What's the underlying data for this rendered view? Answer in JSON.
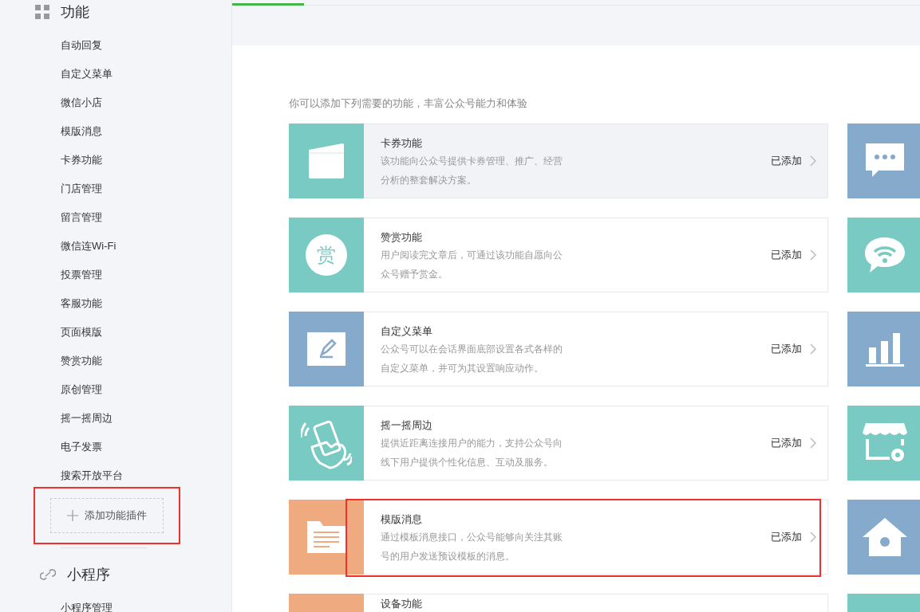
{
  "sidebar": {
    "sections": [
      {
        "kind": "grid",
        "title": "功能",
        "items": [
          {
            "label": "自动回复"
          },
          {
            "label": "自定义菜单"
          },
          {
            "label": "微信小店"
          },
          {
            "label": "模版消息"
          },
          {
            "label": "卡券功能"
          },
          {
            "label": "门店管理"
          },
          {
            "label": "留言管理"
          },
          {
            "label": "微信连Wi-Fi"
          },
          {
            "label": "投票管理"
          },
          {
            "label": "客服功能"
          },
          {
            "label": "页面模版"
          },
          {
            "label": "赞赏功能"
          },
          {
            "label": "原创管理"
          },
          {
            "label": "摇一摇周边"
          },
          {
            "label": "电子发票"
          },
          {
            "label": "搜索开放平台"
          }
        ],
        "add_button": {
          "label": "添加功能插件",
          "highlighted": true
        }
      },
      {
        "kind": "link",
        "title": "小程序",
        "items": [
          {
            "label": "小程序管理"
          }
        ]
      }
    ]
  },
  "intro": "你可以添加下列需要的功能，丰富公众号能力和体验",
  "features": [
    {
      "kind": "card",
      "color": "#78cac2",
      "title": "卡券功能",
      "description": "该功能向公众号提供卡券管理、推广、经营分析的整套解决方案。",
      "status": "已添加",
      "hovered": true,
      "highlighted": false
    },
    {
      "kind": "reward",
      "color": "#78cac2",
      "title": "赞赏功能",
      "description": "用户阅读完文章后，可通过该功能自愿向公众号赠予赏金。",
      "status": "已添加",
      "hovered": false,
      "highlighted": false,
      "badge": "赏"
    },
    {
      "kind": "edit",
      "color": "#85aacb",
      "title": "自定义菜单",
      "description": "公众号可以在会话界面底部设置各式各样的自定义菜单，并可为其设置响应动作。",
      "status": "已添加",
      "hovered": false,
      "highlighted": false
    },
    {
      "kind": "shake",
      "color": "#78cac2",
      "title": "摇一摇周边",
      "description": "提供近距离连接用户的能力，支持公众号向线下用户提供个性化信息、互动及服务。",
      "status": "已添加",
      "hovered": false,
      "highlighted": false
    },
    {
      "kind": "document",
      "color": "#efaa80",
      "title": "模版消息",
      "description": "通过模板消息接口，公众号能够向关注其账号的用户发送预设模板的消息。",
      "status": "已添加",
      "hovered": false,
      "highlighted": true
    },
    {
      "kind": "blank",
      "color": "#efaa80",
      "title": "设备功能",
      "hovered": false,
      "highlighted": false
    }
  ],
  "side_tiles": [
    {
      "kind": "chat",
      "color": "#85aacb"
    },
    {
      "kind": "wifi",
      "color": "#78cac2"
    },
    {
      "kind": "chart",
      "color": "#85aacb"
    },
    {
      "kind": "store",
      "color": "#78cac2"
    },
    {
      "kind": "home",
      "color": "#85aacb"
    },
    {
      "kind": "blank",
      "color": "#78cac2"
    }
  ]
}
